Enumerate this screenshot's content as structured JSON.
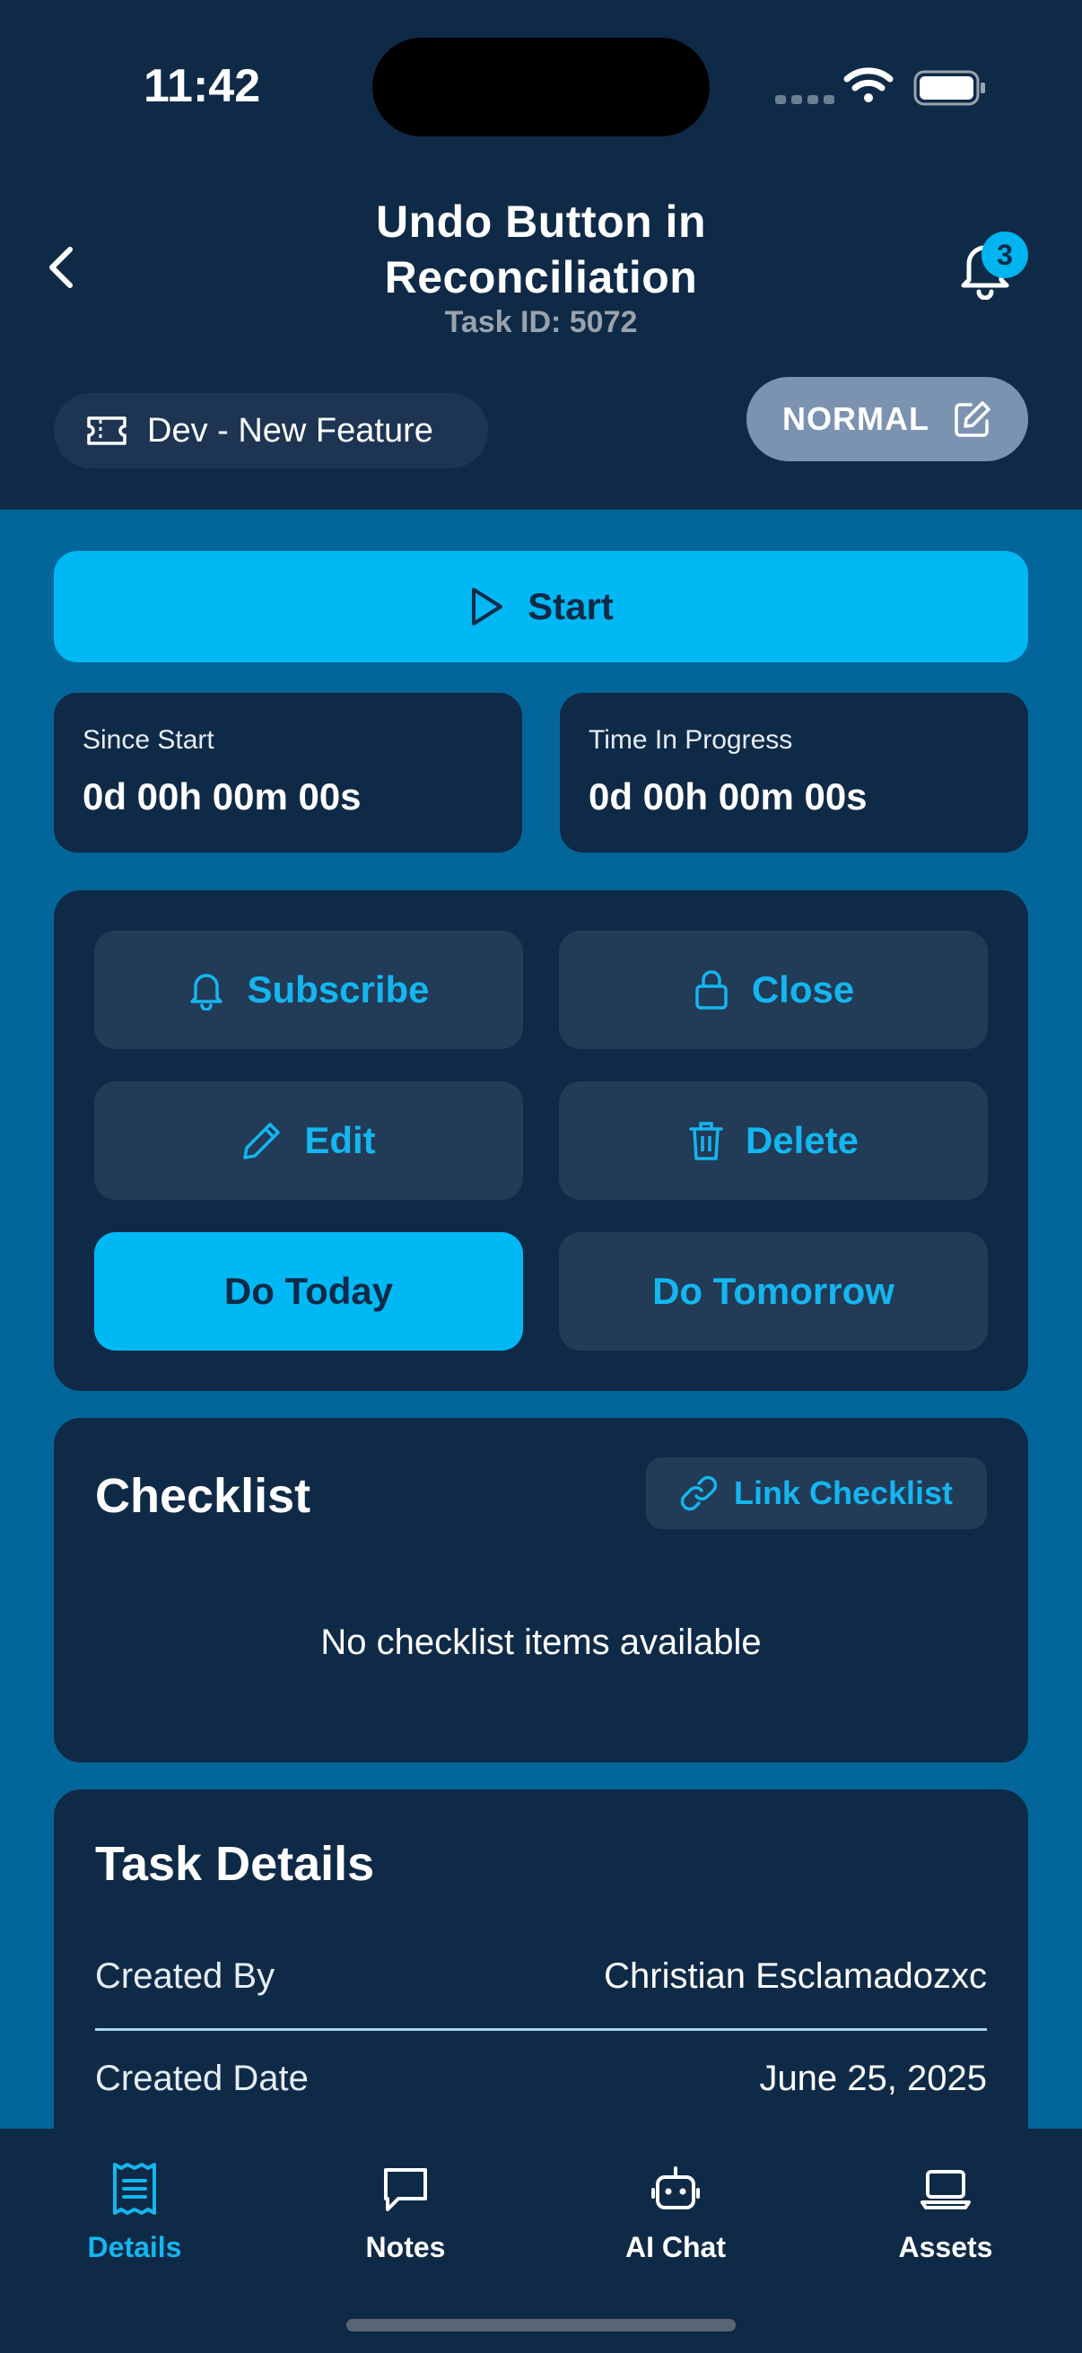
{
  "status_bar": {
    "time": "11:42"
  },
  "header": {
    "title_line1": "Undo Button in",
    "title_line2": "Reconciliation",
    "task_id": "Task ID: 5072",
    "notification_count": "3",
    "category": "Dev - New Feature",
    "priority": "NORMAL"
  },
  "start_button": {
    "label": "Start"
  },
  "timers": [
    {
      "label": "Since Start",
      "value": "0d 00h 00m 00s"
    },
    {
      "label": "Time In Progress",
      "value": "0d 00h 00m 00s"
    }
  ],
  "actions": {
    "subscribe": "Subscribe",
    "close": "Close",
    "edit": "Edit",
    "delete": "Delete",
    "do_today": "Do Today",
    "do_tomorrow": "Do Tomorrow"
  },
  "checklist": {
    "title": "Checklist",
    "link_label": "Link Checklist",
    "empty_message": "No checklist items available"
  },
  "task_details": {
    "title": "Task Details",
    "rows": [
      {
        "key": "Created By",
        "value": "Christian Esclamadozxc"
      },
      {
        "key": "Created Date",
        "value": "June 25, 2025"
      }
    ]
  },
  "tabs": [
    {
      "label": "Details",
      "icon": "receipt-icon",
      "active": true
    },
    {
      "label": "Notes",
      "icon": "chat-bubble-icon",
      "active": false
    },
    {
      "label": "AI Chat",
      "icon": "robot-icon",
      "active": false
    },
    {
      "label": "Assets",
      "icon": "laptop-icon",
      "active": false
    }
  ],
  "colors": {
    "header_bg": "#0f2a47",
    "page_bg": "#03669a",
    "accent": "#00b9f4",
    "priority_chip": "#7b93b0"
  }
}
